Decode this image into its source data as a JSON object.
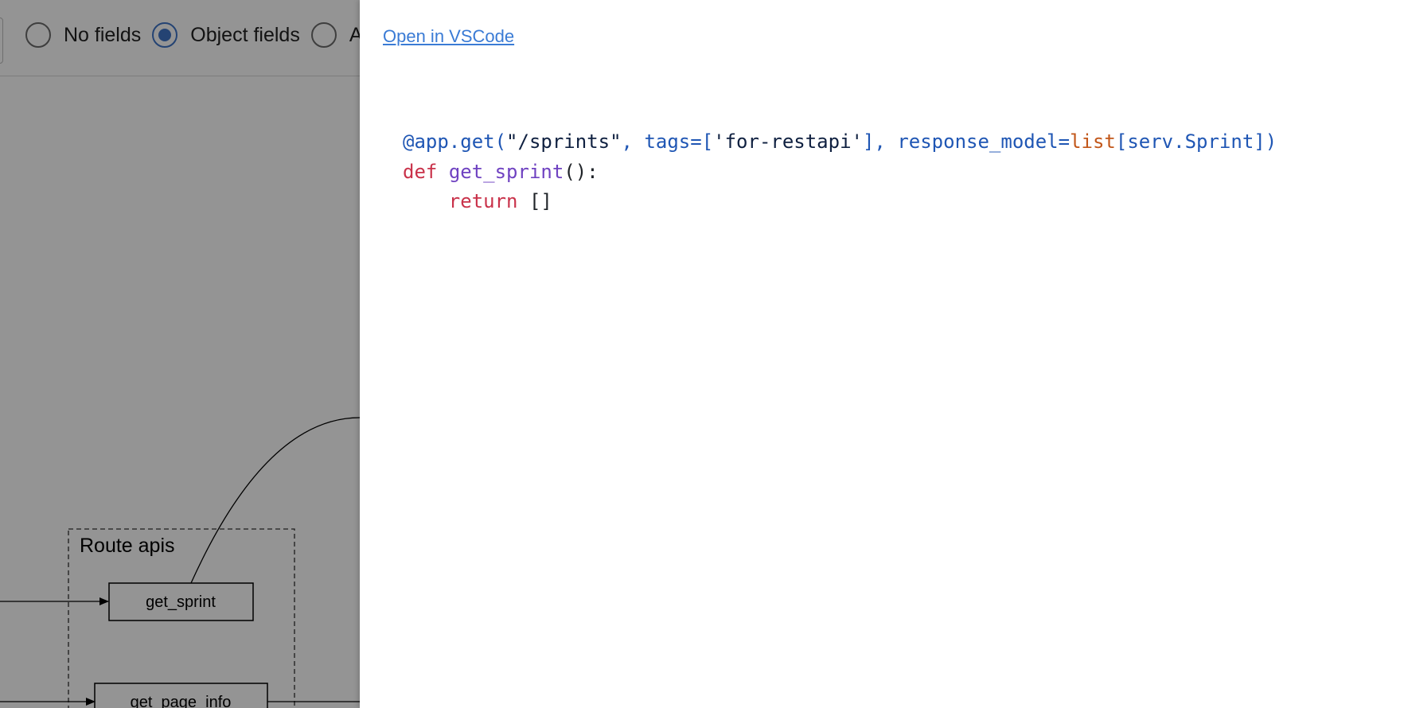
{
  "toolbar": {
    "radio_options": [
      {
        "label": "No fields",
        "selected": false
      },
      {
        "label": "Object fields",
        "selected": true
      },
      {
        "label": "A",
        "selected": false
      }
    ]
  },
  "graph": {
    "cluster_label": "Route apis",
    "nodes": [
      "get_sprint",
      "get_page_info"
    ]
  },
  "drawer": {
    "link_text": "Open in VSCode",
    "code": {
      "line1": {
        "decorator": "@app.get(",
        "path": "\"/sprints\"",
        "tags_key": ", tags=[",
        "tag": "'for-restapi'",
        "model_key": "], response_model=",
        "builtin": "list",
        "model": "[serv.Sprint])"
      },
      "line2": {
        "keyword": "def",
        "name": "get_sprint",
        "rest": "():"
      },
      "line3": {
        "indent": "    ",
        "keyword": "return",
        "rest": " []"
      }
    }
  },
  "colors": {
    "accent": "#3f74c7",
    "link": "#3a7bd5",
    "keyword": "#c9324a",
    "function": "#6f42c1",
    "builtin": "#c2571a",
    "decorator": "#1f56b4"
  }
}
